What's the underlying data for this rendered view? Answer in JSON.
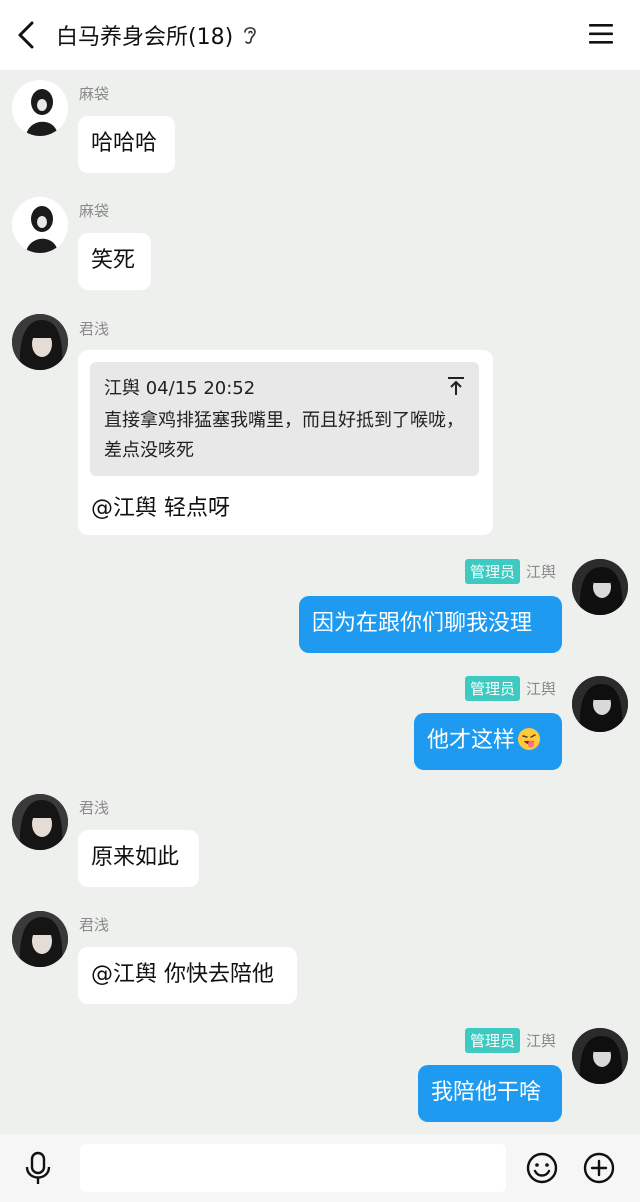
{
  "header": {
    "title": "白马养身会所(18)",
    "back_icon": "chevron-left-icon",
    "ear_icon": "ear-icon",
    "menu_icon": "hamburger-menu-icon"
  },
  "colors": {
    "my_bubble": "#1e9bf0",
    "admin_badge": "#3ec9c1",
    "background": "#eef0ee"
  },
  "messages": [
    {
      "sender": "麻袋",
      "text": "哈哈哈"
    },
    {
      "sender": "麻袋",
      "text": "笑死"
    },
    {
      "sender": "君浅",
      "quote": {
        "meta": "江舆 04/15 20:52",
        "text": "直接拿鸡排猛塞我嘴里，而且好抵到了喉咙，差点没咳死"
      },
      "text": "@江舆 轻点呀"
    },
    {
      "sender": "江舆",
      "badge": "管理员",
      "text": "因为在跟你们聊我没理"
    },
    {
      "sender": "江舆",
      "badge": "管理员",
      "text": "他才这样",
      "emoji": "tongue-wink-emoji"
    },
    {
      "sender": "君浅",
      "text": "原来如此"
    },
    {
      "sender": "君浅",
      "text": "@江舆 你快去陪他"
    },
    {
      "sender": "江舆",
      "badge": "管理员",
      "text": "我陪他干啥"
    }
  ],
  "input_bar": {
    "placeholder": "",
    "mic_icon": "microphone-icon",
    "emoji_icon": "smiley-icon",
    "plus_icon": "plus-circle-icon"
  }
}
